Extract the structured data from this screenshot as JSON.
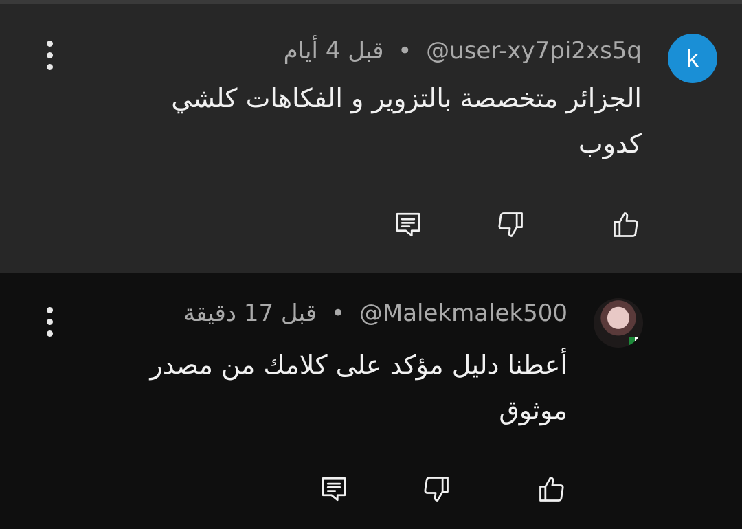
{
  "comments": [
    {
      "avatar_letter": "k",
      "avatar_color": "#1a8fd6",
      "author": "@user-xy7pi2xs5q",
      "separator": "•",
      "time": "قبل 4 أيام",
      "text": "الجزائر  متخصصة بالتزوير و الفكاهات كلشي كدوب",
      "icons": {
        "menu": "more-vert-icon",
        "like": "thumb-up-icon",
        "dislike": "thumb-down-icon",
        "reply": "reply-comment-icon"
      }
    },
    {
      "avatar_letter": "",
      "author": "@Malekmalek500",
      "separator": "•",
      "time": "قبل 17 دقيقة",
      "text": "أعطنا دليل مؤكد على كلامك من مصدر موثوق",
      "icons": {
        "menu": "more-vert-icon",
        "like": "thumb-up-icon",
        "dislike": "thumb-down-icon",
        "reply": "reply-comment-icon"
      }
    }
  ],
  "colors": {
    "background": "#0f0f0f",
    "highlighted_background": "#272727",
    "meta_text": "#aaaaaa",
    "body_text": "#f1f1f1"
  }
}
